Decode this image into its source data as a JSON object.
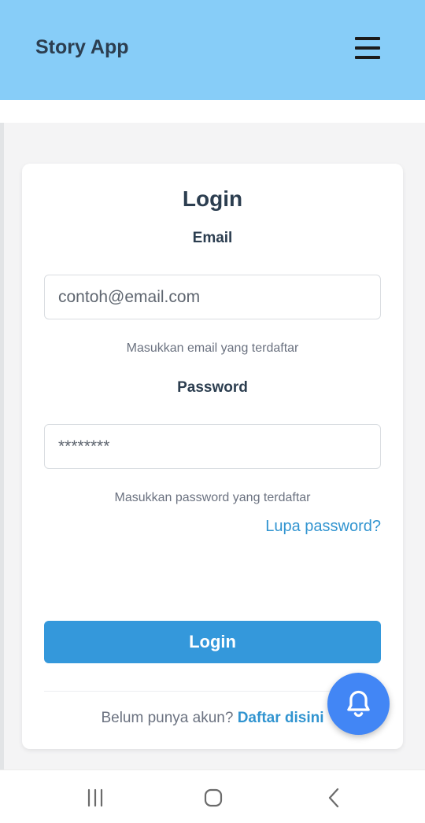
{
  "header": {
    "title": "Story App",
    "menu_icon": "hamburger-menu-icon"
  },
  "login": {
    "title": "Login",
    "email": {
      "label": "Email",
      "placeholder": "contoh@email.com",
      "value": "",
      "helper": "Masukkan email yang terdaftar"
    },
    "password": {
      "label": "Password",
      "placeholder": "********",
      "value": "",
      "helper": "Masukkan password yang terdaftar"
    },
    "forgot_label": "Lupa password?",
    "submit_label": "Login",
    "register_prompt": "Belum punya akun?",
    "register_link": "Daftar disini"
  },
  "fab": {
    "icon": "bell-icon"
  },
  "navbar": {
    "icons": [
      "recent-apps-icon",
      "home-icon",
      "back-icon"
    ]
  },
  "colors": {
    "header_bg": "#87cdf8",
    "primary": "#3498db",
    "link": "#3194d0",
    "fab": "#4286f5",
    "page_bg": "#f4f4f5"
  }
}
